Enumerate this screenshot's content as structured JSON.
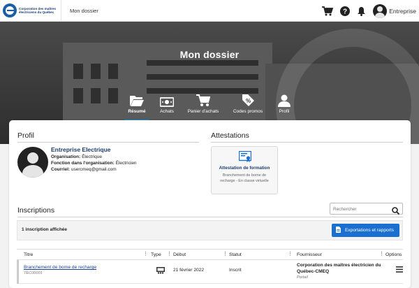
{
  "header": {
    "logo_text": "Corporation des maîtres électriciens du Québec",
    "breadcrumb": "Mon dossier",
    "user_name": "Entreprise",
    "icons": [
      "cart-icon",
      "help-icon",
      "bell-icon",
      "avatar"
    ]
  },
  "hero": {
    "title": "Mon dossier",
    "tabs": [
      {
        "label": "Résumé",
        "icon": "folder-open-icon",
        "active": true
      },
      {
        "label": "Achats",
        "icon": "money-icon",
        "active": false
      },
      {
        "label": "Panier d'achats",
        "icon": "cart-icon",
        "active": false
      },
      {
        "label": "Codes promos",
        "icon": "tag-percent-icon",
        "active": false
      },
      {
        "label": "Profil",
        "icon": "user-icon",
        "active": false
      }
    ]
  },
  "profil": {
    "heading": "Profil",
    "name": "Entreprise Electrique",
    "organisation_label": "Organisation:",
    "organisation_value": "Électrique",
    "fonction_label": "Fonction dans l'organisation:",
    "fonction_value": "Électricien",
    "courriel_label": "Courriel:",
    "courriel_value": "usercmeq@gmail.com"
  },
  "attestations": {
    "heading": "Attestations",
    "card_title": "Attestation de formation",
    "card_subtitle_1": "Branchement de borne de",
    "card_subtitle_2": "recharge - En classe virtuelle"
  },
  "inscriptions": {
    "heading": "Inscriptions",
    "search_placeholder": "Rechercher",
    "count_text": "1 inscription affichée",
    "export_label": "Exportations et rapports",
    "columns": [
      "Titre",
      "Type",
      "Début",
      "Statut",
      "Fournisseur",
      "Options"
    ],
    "rows": [
      {
        "title": "Branchement de borne de recharge",
        "code": "TEC00001",
        "type_icon": "classroom-icon",
        "start": "21 février 2022",
        "status": "Inscrit",
        "provider_1": "Corporation des maîtres électricien du",
        "provider_2": "Québec-CMEQ",
        "provider_sub": "Portail"
      }
    ]
  },
  "colors": {
    "primary": "#1a6fd0",
    "navy": "#1c3c6c",
    "tab_underline": "#1a8fd0"
  }
}
